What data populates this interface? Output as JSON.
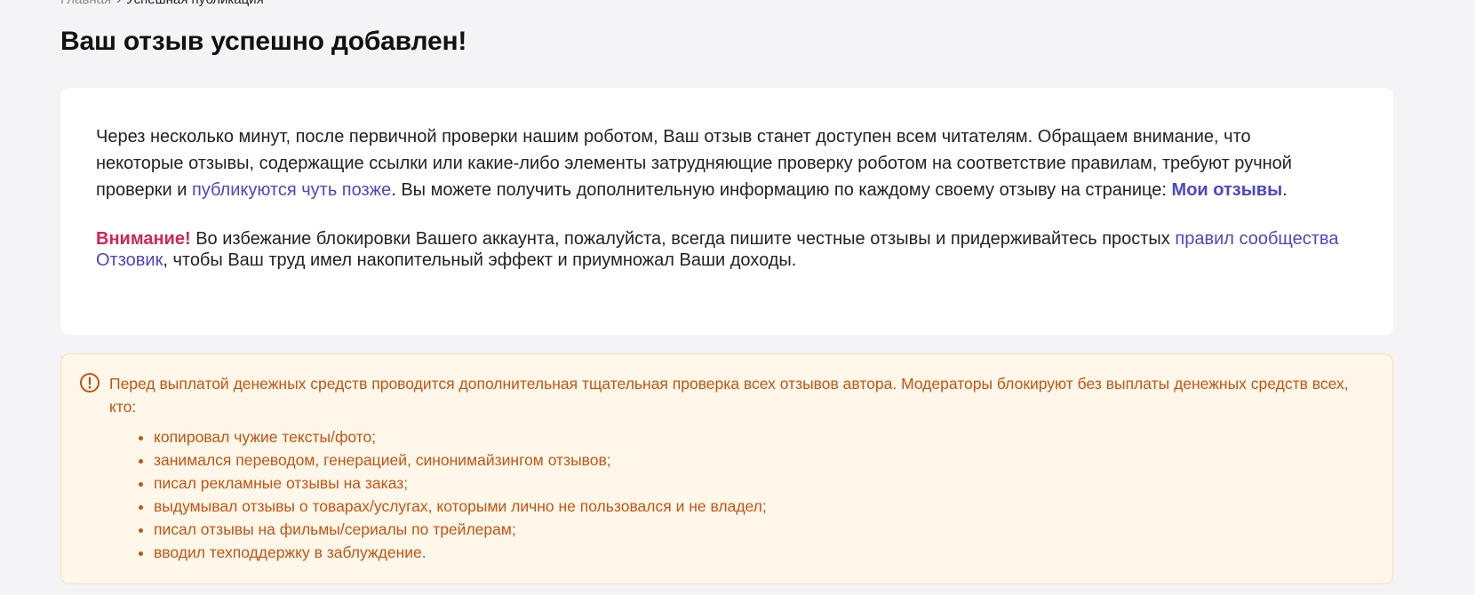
{
  "breadcrumb": {
    "home": "Главная",
    "separator": "›",
    "current": "Успешная публикация"
  },
  "page_title": "Ваш отзыв успешно добавлен!",
  "info": {
    "p1_text1": "Через несколько минут, после первичной проверки нашим роботом, Ваш отзыв станет доступен всем читателям. Обращаем внимание, что некоторые отзывы, содержащие ссылки или какие-либо элементы затрудняющие проверку роботом на соответствие правилам, требуют ручной проверки и ",
    "p1_link": "публикуются чуть позже",
    "p1_text2": ". Вы можете получить дополнительную информацию по каждому своему отзыву на странице: ",
    "p1_link_my_reviews": "Мои отзывы",
    "p1_end": ".",
    "attention_label": "Внимание!",
    "p2_text1": " Во избежание блокировки Вашего аккаунта, пожалуйста, всегда пишите честные отзывы и придерживайтесь простых ",
    "p2_link": "правил сообщества Отзовик",
    "p2_text2": ", чтобы Ваш труд имел накопительный эффект и приумножал Ваши доходы."
  },
  "notice": {
    "icon": "exclamation-circle-icon",
    "text": "Перед выплатой денежных средств проводится дополнительная тщательная проверка всех отзывов автора. Модераторы блокируют без выплаты денежных средств всех, кто:",
    "items": [
      "копировал чужие тексты/фото;",
      "занимался переводом, генерацией, синонимайзингом отзывов;",
      "писал рекламные отзывы на заказ;",
      "выдумывал отзывы о товарах/услугах, которыми лично не пользовался и не владел;",
      "писал отзывы на фильмы/сериалы по трейлерам;",
      "вводил техподдержку в заблуждение."
    ]
  },
  "colors": {
    "background": "#f4f4f6",
    "link": "#4b47c4",
    "attention": "#d0245a",
    "notice_text": "#c65311",
    "notice_bg": "#fff8ea"
  }
}
